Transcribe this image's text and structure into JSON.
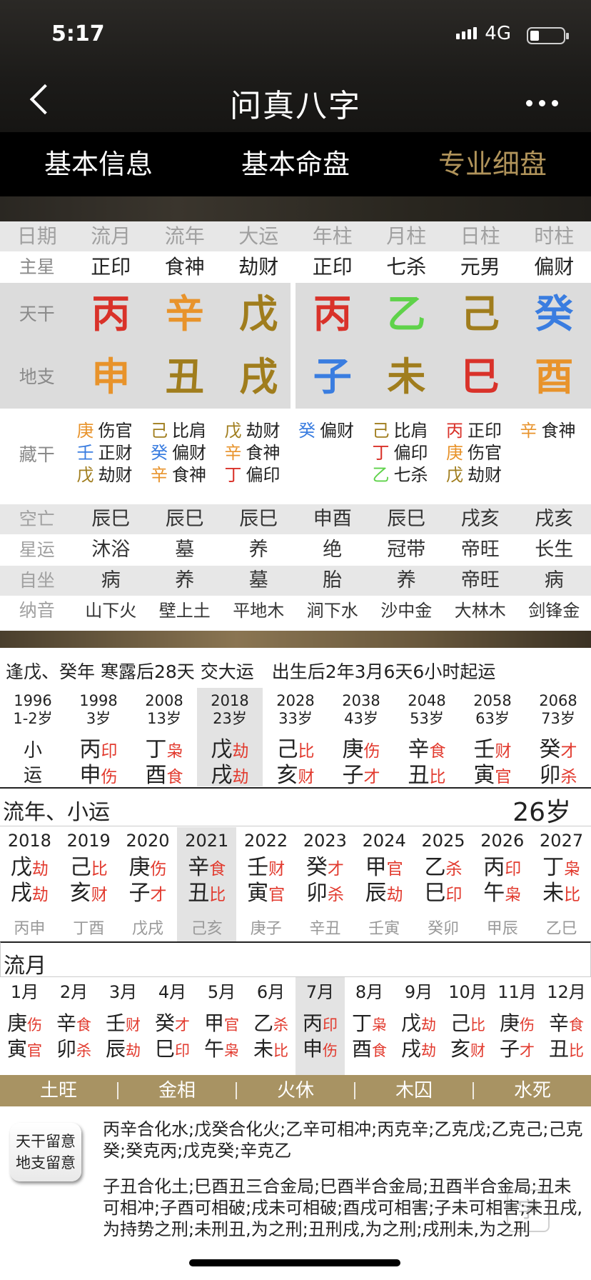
{
  "status": {
    "time": "5:17",
    "network": "4G"
  },
  "nav": {
    "title": "问真八字"
  },
  "tabs": [
    "基本信息",
    "基本命盘",
    "专业细盘"
  ],
  "chart": {
    "headers": [
      "日期",
      "流月",
      "流年",
      "大运",
      "年柱",
      "月柱",
      "日柱",
      "时柱"
    ],
    "star_label": "主星",
    "stars": [
      "正印",
      "食神",
      "劫财",
      "正印",
      "七杀",
      "元男",
      "偏财"
    ],
    "tg_label": "天干",
    "tiangan": [
      {
        "t": "丙",
        "c": "red"
      },
      {
        "t": "辛",
        "c": "orange"
      },
      {
        "t": "戊",
        "c": "olive"
      },
      {
        "t": "丙",
        "c": "red"
      },
      {
        "t": "乙",
        "c": "green"
      },
      {
        "t": "己",
        "c": "olive"
      },
      {
        "t": "癸",
        "c": "blue"
      }
    ],
    "dz_label": "地支",
    "dizhi": [
      {
        "t": "申",
        "c": "orange"
      },
      {
        "t": "丑",
        "c": "olive"
      },
      {
        "t": "戌",
        "c": "olive"
      },
      {
        "t": "子",
        "c": "blue"
      },
      {
        "t": "未",
        "c": "olive"
      },
      {
        "t": "巳",
        "c": "red"
      },
      {
        "t": "酉",
        "c": "orange"
      }
    ],
    "cg_label": "藏干",
    "canggan": [
      [
        {
          "g": "庚",
          "c": "orange",
          "s": "伤官"
        },
        {
          "g": "壬",
          "c": "blue",
          "s": "正财"
        },
        {
          "g": "戊",
          "c": "olive",
          "s": "劫财"
        }
      ],
      [
        {
          "g": "己",
          "c": "olive",
          "s": "比肩"
        },
        {
          "g": "癸",
          "c": "blue",
          "s": "偏财"
        },
        {
          "g": "辛",
          "c": "orange",
          "s": "食神"
        }
      ],
      [
        {
          "g": "戊",
          "c": "olive",
          "s": "劫财"
        },
        {
          "g": "辛",
          "c": "orange",
          "s": "食神"
        },
        {
          "g": "丁",
          "c": "red",
          "s": "偏印"
        }
      ],
      [
        {
          "g": "癸",
          "c": "blue",
          "s": "偏财"
        }
      ],
      [
        {
          "g": "己",
          "c": "olive",
          "s": "比肩"
        },
        {
          "g": "丁",
          "c": "red",
          "s": "偏印"
        },
        {
          "g": "乙",
          "c": "green",
          "s": "七杀"
        }
      ],
      [
        {
          "g": "丙",
          "c": "red",
          "s": "正印"
        },
        {
          "g": "庚",
          "c": "orange",
          "s": "伤官"
        },
        {
          "g": "戊",
          "c": "olive",
          "s": "劫财"
        }
      ],
      [
        {
          "g": "辛",
          "c": "orange",
          "s": "食神"
        }
      ]
    ],
    "kw_label": "空亡",
    "kongwang": [
      "辰巳",
      "辰巳",
      "辰巳",
      "申酉",
      "辰巳",
      "戌亥",
      "戌亥"
    ],
    "xy_label": "星运",
    "xingyun": [
      "沐浴",
      "墓",
      "养",
      "绝",
      "冠带",
      "帝旺",
      "长生"
    ],
    "zz_label": "自坐",
    "zizuo": [
      "病",
      "养",
      "墓",
      "胎",
      "养",
      "帝旺",
      "病"
    ],
    "ny_label": "纳音",
    "nayin": [
      "山下火",
      "壁上土",
      "平地木",
      "涧下水",
      "沙中金",
      "大林木",
      "剑锋金"
    ]
  },
  "dayun": {
    "note": "逢戊、癸年 寒露后28天 交大运　出生后2年3月6天6小时起运",
    "items": [
      {
        "year": "1996",
        "age": "1-2岁",
        "g": "小",
        "gs": "",
        "z": "运",
        "zs": "",
        "xy": true
      },
      {
        "year": "1998",
        "age": "3岁",
        "g": "丙",
        "gs": "印",
        "z": "申",
        "zs": "伤"
      },
      {
        "year": "2008",
        "age": "13岁",
        "g": "丁",
        "gs": "枭",
        "z": "酉",
        "zs": "食"
      },
      {
        "year": "2018",
        "age": "23岁",
        "g": "戊",
        "gs": "劫",
        "z": "戌",
        "zs": "劫",
        "hl": true
      },
      {
        "year": "2028",
        "age": "33岁",
        "g": "己",
        "gs": "比",
        "z": "亥",
        "zs": "财"
      },
      {
        "year": "2038",
        "age": "43岁",
        "g": "庚",
        "gs": "伤",
        "z": "子",
        "zs": "才"
      },
      {
        "year": "2048",
        "age": "53岁",
        "g": "辛",
        "gs": "食",
        "z": "丑",
        "zs": "比"
      },
      {
        "year": "2058",
        "age": "63岁",
        "g": "壬",
        "gs": "财",
        "z": "寅",
        "zs": "官"
      },
      {
        "year": "2068",
        "age": "73岁",
        "g": "癸",
        "gs": "才",
        "z": "卯",
        "zs": "杀"
      }
    ]
  },
  "liunian": {
    "title": "流年、小运",
    "age": "26岁",
    "items": [
      {
        "year": "2018",
        "g": "戊",
        "gs": "劫",
        "z": "戌",
        "zs": "劫",
        "xy": "丙申"
      },
      {
        "year": "2019",
        "g": "己",
        "gs": "比",
        "z": "亥",
        "zs": "财",
        "xy": "丁酉"
      },
      {
        "year": "2020",
        "g": "庚",
        "gs": "伤",
        "z": "子",
        "zs": "才",
        "xy": "戊戌"
      },
      {
        "year": "2021",
        "g": "辛",
        "gs": "食",
        "z": "丑",
        "zs": "比",
        "xy": "己亥",
        "hl": true
      },
      {
        "year": "2022",
        "g": "壬",
        "gs": "财",
        "z": "寅",
        "zs": "官",
        "xy": "庚子"
      },
      {
        "year": "2023",
        "g": "癸",
        "gs": "才",
        "z": "卯",
        "zs": "杀",
        "xy": "辛丑"
      },
      {
        "year": "2024",
        "g": "甲",
        "gs": "官",
        "z": "辰",
        "zs": "劫",
        "xy": "壬寅"
      },
      {
        "year": "2025",
        "g": "乙",
        "gs": "杀",
        "z": "巳",
        "zs": "印",
        "xy": "癸卯"
      },
      {
        "year": "2026",
        "g": "丙",
        "gs": "印",
        "z": "午",
        "zs": "枭",
        "xy": "甲辰"
      },
      {
        "year": "2027",
        "g": "丁",
        "gs": "枭",
        "z": "未",
        "zs": "比",
        "xy": "乙巳"
      }
    ]
  },
  "liuyue": {
    "title": "流月",
    "items": [
      {
        "m": "1月",
        "g": "庚",
        "gs": "伤",
        "z": "寅",
        "zs": "官"
      },
      {
        "m": "2月",
        "g": "辛",
        "gs": "食",
        "z": "卯",
        "zs": "杀"
      },
      {
        "m": "3月",
        "g": "壬",
        "gs": "财",
        "z": "辰",
        "zs": "劫"
      },
      {
        "m": "4月",
        "g": "癸",
        "gs": "才",
        "z": "巳",
        "zs": "印"
      },
      {
        "m": "5月",
        "g": "甲",
        "gs": "官",
        "z": "午",
        "zs": "枭"
      },
      {
        "m": "6月",
        "g": "乙",
        "gs": "杀",
        "z": "未",
        "zs": "比"
      },
      {
        "m": "7月",
        "g": "丙",
        "gs": "印",
        "z": "申",
        "zs": "伤",
        "hl": true
      },
      {
        "m": "8月",
        "g": "丁",
        "gs": "枭",
        "z": "酉",
        "zs": "食"
      },
      {
        "m": "9月",
        "g": "戊",
        "gs": "劫",
        "z": "戌",
        "zs": "劫"
      },
      {
        "m": "10月",
        "g": "己",
        "gs": "比",
        "z": "亥",
        "zs": "财"
      },
      {
        "m": "11月",
        "g": "庚",
        "gs": "伤",
        "z": "子",
        "zs": "才"
      },
      {
        "m": "12月",
        "g": "辛",
        "gs": "食",
        "z": "丑",
        "zs": "比"
      }
    ]
  },
  "wuxing": [
    "土旺",
    "金相",
    "火休",
    "木囚",
    "水死"
  ],
  "notes": {
    "button_line1": "天干留意",
    "button_line2": "地支留意",
    "tiangan": "丙辛合化水;戊癸合化火;乙辛可相冲;丙克辛;乙克戊;乙克己;己克癸;癸克丙;戊克癸;辛克乙",
    "dizhi": "子丑合化土;巳酉丑三合金局;巳酉半合金局;丑酉半合金局;丑未可相冲;子酉可相破;戌未可相破;酉戌可相害;子未可相害;未丑戌,为持势之刑;未刑丑,为之刑;丑刑戌,为之刑;戌刑未,为之刑"
  },
  "colors": {
    "red": "#d9322a",
    "orange": "#e8932b",
    "olive": "#a07d1d",
    "green": "#5fd24a",
    "blue": "#3a7de0",
    "accent": "#b0935a",
    "strip": "#a89363"
  }
}
